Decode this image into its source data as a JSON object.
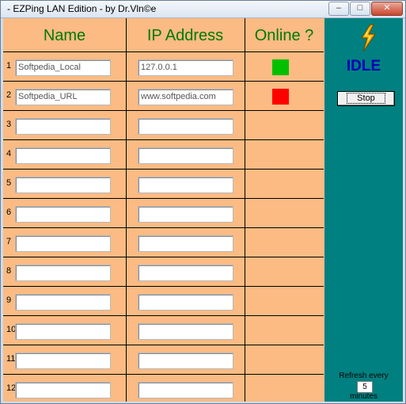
{
  "window": {
    "title": "- EZPing LAN Edition - by Dr.Vln©e",
    "min_label": "–",
    "max_label": "□",
    "close_label": "✕"
  },
  "headers": {
    "name": "Name",
    "ip": "IP Address",
    "online": "Online ?"
  },
  "rows": [
    {
      "num": "1",
      "name": "Softpedia_Local",
      "ip": "127.0.0.1",
      "status": "online"
    },
    {
      "num": "2",
      "name": "Softpedia_URL",
      "ip": "www.softpedia.com",
      "status": "offline"
    },
    {
      "num": "3",
      "name": "",
      "ip": "",
      "status": ""
    },
    {
      "num": "4",
      "name": "",
      "ip": "",
      "status": ""
    },
    {
      "num": "5",
      "name": "",
      "ip": "",
      "status": ""
    },
    {
      "num": "6",
      "name": "",
      "ip": "",
      "status": ""
    },
    {
      "num": "7",
      "name": "",
      "ip": "",
      "status": ""
    },
    {
      "num": "8",
      "name": "",
      "ip": "",
      "status": ""
    },
    {
      "num": "9",
      "name": "",
      "ip": "",
      "status": ""
    },
    {
      "num": "10",
      "name": "",
      "ip": "",
      "status": ""
    },
    {
      "num": "11",
      "name": "",
      "ip": "",
      "status": ""
    },
    {
      "num": "12",
      "name": "",
      "ip": "",
      "status": ""
    }
  ],
  "panel": {
    "icon": "lightning-bolt-icon",
    "state": "IDLE",
    "stop_label": "Stop",
    "refresh_label": "Refresh every",
    "refresh_value": "5",
    "minutes_label": "minutes"
  },
  "colors": {
    "background": "#fbbb83",
    "header_text": "#007a00",
    "panel": "#008080",
    "idle_text": "#0000b8",
    "online": "#00c000",
    "offline": "#ff0000"
  }
}
